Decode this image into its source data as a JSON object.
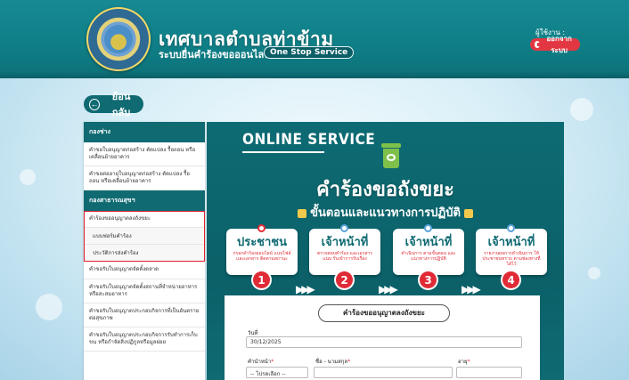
{
  "header": {
    "title": "เทศบาลตำบลท่าข้าม",
    "subtitle": "ระบบยื่นคำร้องขอออนไลน์",
    "badge": "One Stop Service",
    "user_label": "ผู้ใช้งาน :",
    "logout_label": "ออกจากระบบ"
  },
  "back_label": "ย้อนกลับ",
  "sidebar": {
    "section1": "กองช่าง",
    "items1": [
      "คำขอใบอนุญาตก่อสร้าง ดัดแปลง รื้อถอน หรือเคลื่อนย้ายอาคาร",
      "คำขอต่ออายุใบอนุญาตก่อสร้าง ดัดแปลง รื้อถอน หรือเคลื่อนย้ายอาคาร"
    ],
    "section2": "กองสาธารณสุขฯ",
    "highlight_item": "คำร้องขออนุญาตลงถังขยะ",
    "sub_items": [
      "แบบฟอร์มคำร้อง",
      "ประวัติการส่งคำร้อง"
    ],
    "items2": [
      "คำขอรับใบอนุญาตจัดตั้งตลาด",
      "คำขอรับใบอนุญาตจัดตั้งสถานที่จำหน่ายอาหาร หรือสะสมอาหาร",
      "คำขอรับใบอนุญาตประกอบกิจการที่เป็นอันตรายต่อสุขภาพ",
      "คำขอรับใบอนุญาตประกอบกิจการรับทำการเก็บ ขน หรือกำจัดสิ่งปฏิกูลหรือมูลฝอย"
    ]
  },
  "panel": {
    "online_label": "ONLINE SERVICE",
    "big_title": "คำร้องขอถังขยะ",
    "steps_title": "ขั้นตอนและแนวทางการปฏิบัติ",
    "steps": [
      {
        "role": "ประชาชน",
        "desc": "กรอกคำร้องออนไลน์ แนบไฟล์และเอกสาร ติดตามสถานะ",
        "num": "1"
      },
      {
        "role": "เจ้าหน้าที่",
        "desc": "ตรวจสอบคำร้อง และเอกสารแนบ รับเข้าการรับเรื่อง",
        "num": "2"
      },
      {
        "role": "เจ้าหน้าที่",
        "desc": "ดำเนินการ ตามขั้นตอน และแนวทางการปฏิบัติ",
        "num": "3"
      },
      {
        "role": "เจ้าหน้าที่",
        "desc": "รายงานผลการดำเนินการ ให้ประชาชนทราบ ตามช่องทางที่ได้ไว้",
        "num": "4"
      }
    ],
    "arrows": "▶▶▶"
  },
  "form": {
    "title": "คำร้องขออนุญาตลงถังขยะ",
    "date_label": "วันที่",
    "date_value": "30/12/2025",
    "prefix_label": "คำนำหน้า",
    "prefix_value": "-- โปรดเลือก --",
    "name_label": "ชื่อ - นามสกุล",
    "age_label": "อายุ"
  },
  "colors": {
    "teal": "#0f6a72",
    "red": "#e02b36",
    "header": "#168a93"
  }
}
